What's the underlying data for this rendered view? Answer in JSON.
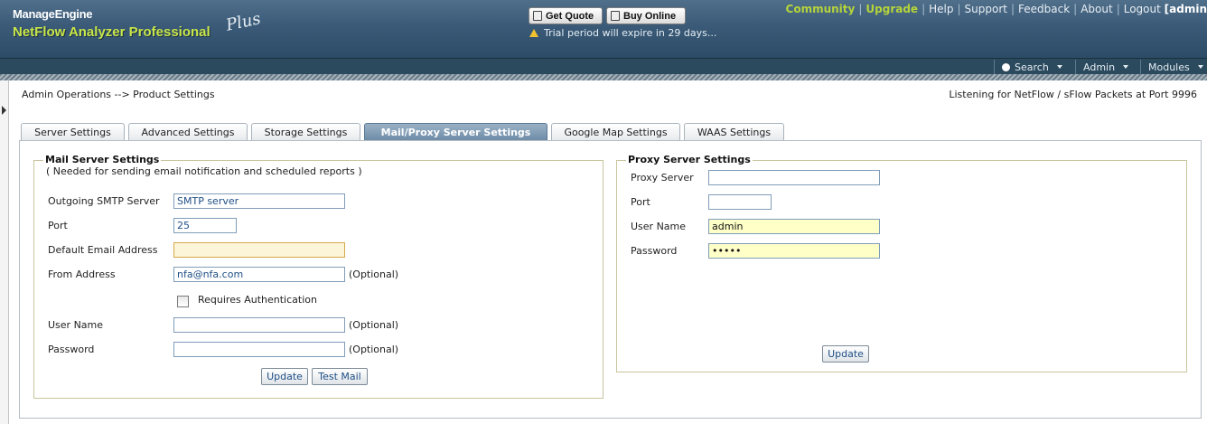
{
  "header": {
    "brand_top": "ManageEngine",
    "brand_bottom": "NetFlow Analyzer Professional",
    "brand_plus": "Plus",
    "get_quote": "Get Quote",
    "buy_online": "Buy Online",
    "trial_text": "Trial period will expire in 29 days...",
    "links": {
      "community": "Community",
      "upgrade": "Upgrade",
      "help": "Help",
      "support": "Support",
      "feedback": "Feedback",
      "about": "About",
      "logout": "Logout",
      "user": "[admin"
    }
  },
  "nav": {
    "search": "Search",
    "admin": "Admin",
    "modules": "Modules"
  },
  "breadcrumb": "Admin Operations --> Product Settings",
  "status": "Listening for NetFlow / sFlow Packets at Port 9996",
  "tabs": [
    {
      "label": "Server Settings"
    },
    {
      "label": "Advanced Settings"
    },
    {
      "label": "Storage Settings"
    },
    {
      "label": "Mail/Proxy Server Settings"
    },
    {
      "label": "Google Map Settings"
    },
    {
      "label": "WAAS Settings"
    }
  ],
  "mail": {
    "legend": "Mail Server Settings",
    "note": "( Needed for sending email notification and scheduled reports )",
    "smtp_label": "Outgoing SMTP Server",
    "smtp_value": "SMTP server",
    "port_label": "Port",
    "port_value": "25",
    "default_email_label": "Default Email Address",
    "default_email_value": "",
    "from_label": "From Address",
    "from_value": "nfa@nfa.com",
    "optional": "(Optional)",
    "auth_label": "Requires Authentication",
    "username_label": "User Name",
    "username_value": "",
    "password_label": "Password",
    "password_value": "",
    "update": "Update",
    "test_mail": "Test Mail"
  },
  "proxy": {
    "legend": "Proxy Server Settings",
    "server_label": "Proxy Server",
    "server_value": "",
    "port_label": "Port",
    "port_value": "",
    "username_label": "User Name",
    "username_value": "admin",
    "password_label": "Password",
    "password_value": "admin",
    "update": "Update"
  }
}
